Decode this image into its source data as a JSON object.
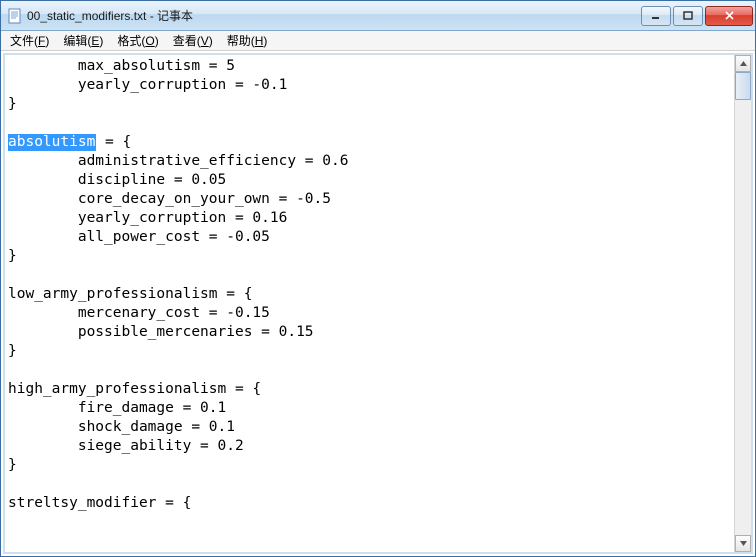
{
  "title": "00_static_modifiers.txt - 记事本",
  "menus": {
    "file": "文件(F)",
    "edit": "编辑(E)",
    "format": "格式(O)",
    "view": "查看(V)",
    "help": "帮助(H)"
  },
  "selection": "absolutism",
  "lines": [
    "        max_absolutism = 5",
    "        yearly_corruption = -0.1",
    "}",
    "",
    "@@SEL@@ = {",
    "        administrative_efficiency = 0.6",
    "        discipline = 0.05",
    "        core_decay_on_your_own = -0.5",
    "        yearly_corruption = 0.16",
    "        all_power_cost = -0.05",
    "}",
    "",
    "low_army_professionalism = {",
    "        mercenary_cost = -0.15",
    "        possible_mercenaries = 0.15",
    "}",
    "",
    "high_army_professionalism = {",
    "        fire_damage = 0.1",
    "        shock_damage = 0.1",
    "        siege_ability = 0.2",
    "}",
    "",
    "streltsy_modifier = {"
  ]
}
